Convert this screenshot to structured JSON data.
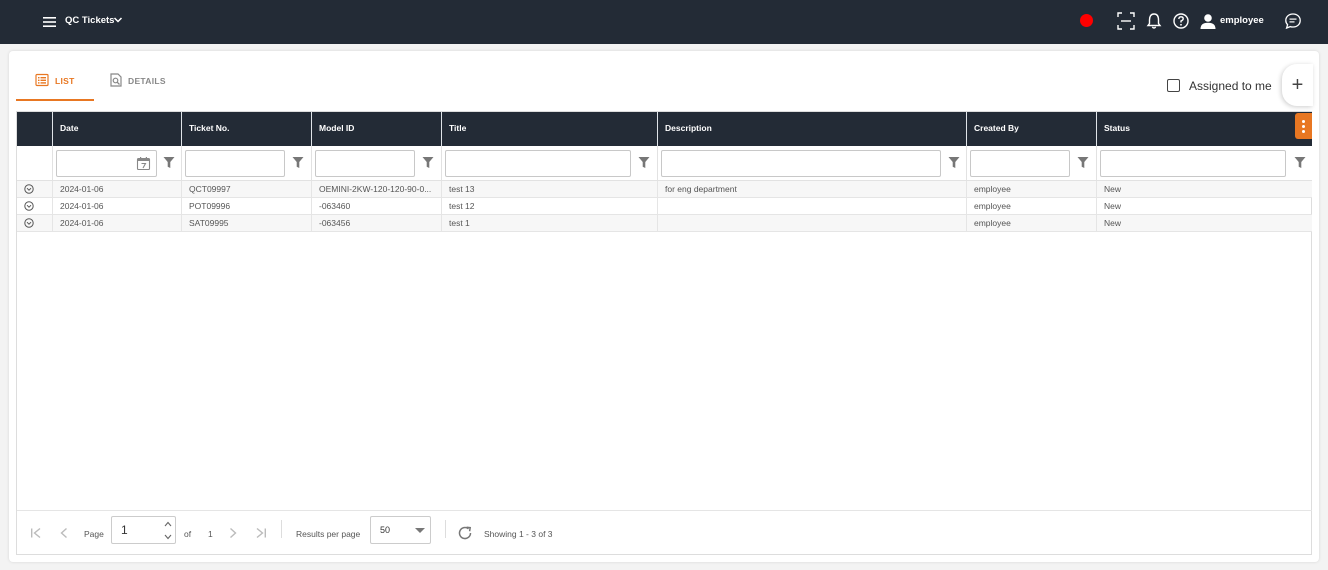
{
  "app": {
    "title": "QC Tickets",
    "user": "employee",
    "recording_color": "#ff0000"
  },
  "tabs": [
    {
      "label": "LIST",
      "icon": "list-icon",
      "active": true
    },
    {
      "label": "DETAILS",
      "icon": "document-search-icon",
      "active": false
    }
  ],
  "toolbar": {
    "assigned_label": "Assigned to me",
    "add_label": "+"
  },
  "grid": {
    "columns": [
      "",
      "Date",
      "Ticket No.",
      "Model ID",
      "Title",
      "Description",
      "Created By",
      "Status"
    ],
    "rows": [
      {
        "date": "2024-01-06",
        "ticket": "QCT09997",
        "model": "OEMINI-2KW-120-120-90-0...",
        "title": "test 13",
        "description": "for eng department",
        "created_by": "employee",
        "status": "New"
      },
      {
        "date": "2024-01-06",
        "ticket": "POT09996",
        "model": "-063460",
        "title": "test 12",
        "description": "",
        "created_by": "employee",
        "status": "New"
      },
      {
        "date": "2024-01-06",
        "ticket": "SAT09995",
        "model": "-063456",
        "title": "test 1",
        "description": "",
        "created_by": "employee",
        "status": "New"
      }
    ]
  },
  "pager": {
    "page_label": "Page",
    "page_value": "1",
    "of_label": "of",
    "total_pages": "1",
    "rpp_label": "Results per page",
    "rpp_value": "50",
    "showing": "Showing 1 - 3 of 3"
  },
  "colors": {
    "accent": "#e87722",
    "header_bg": "#232b36"
  }
}
